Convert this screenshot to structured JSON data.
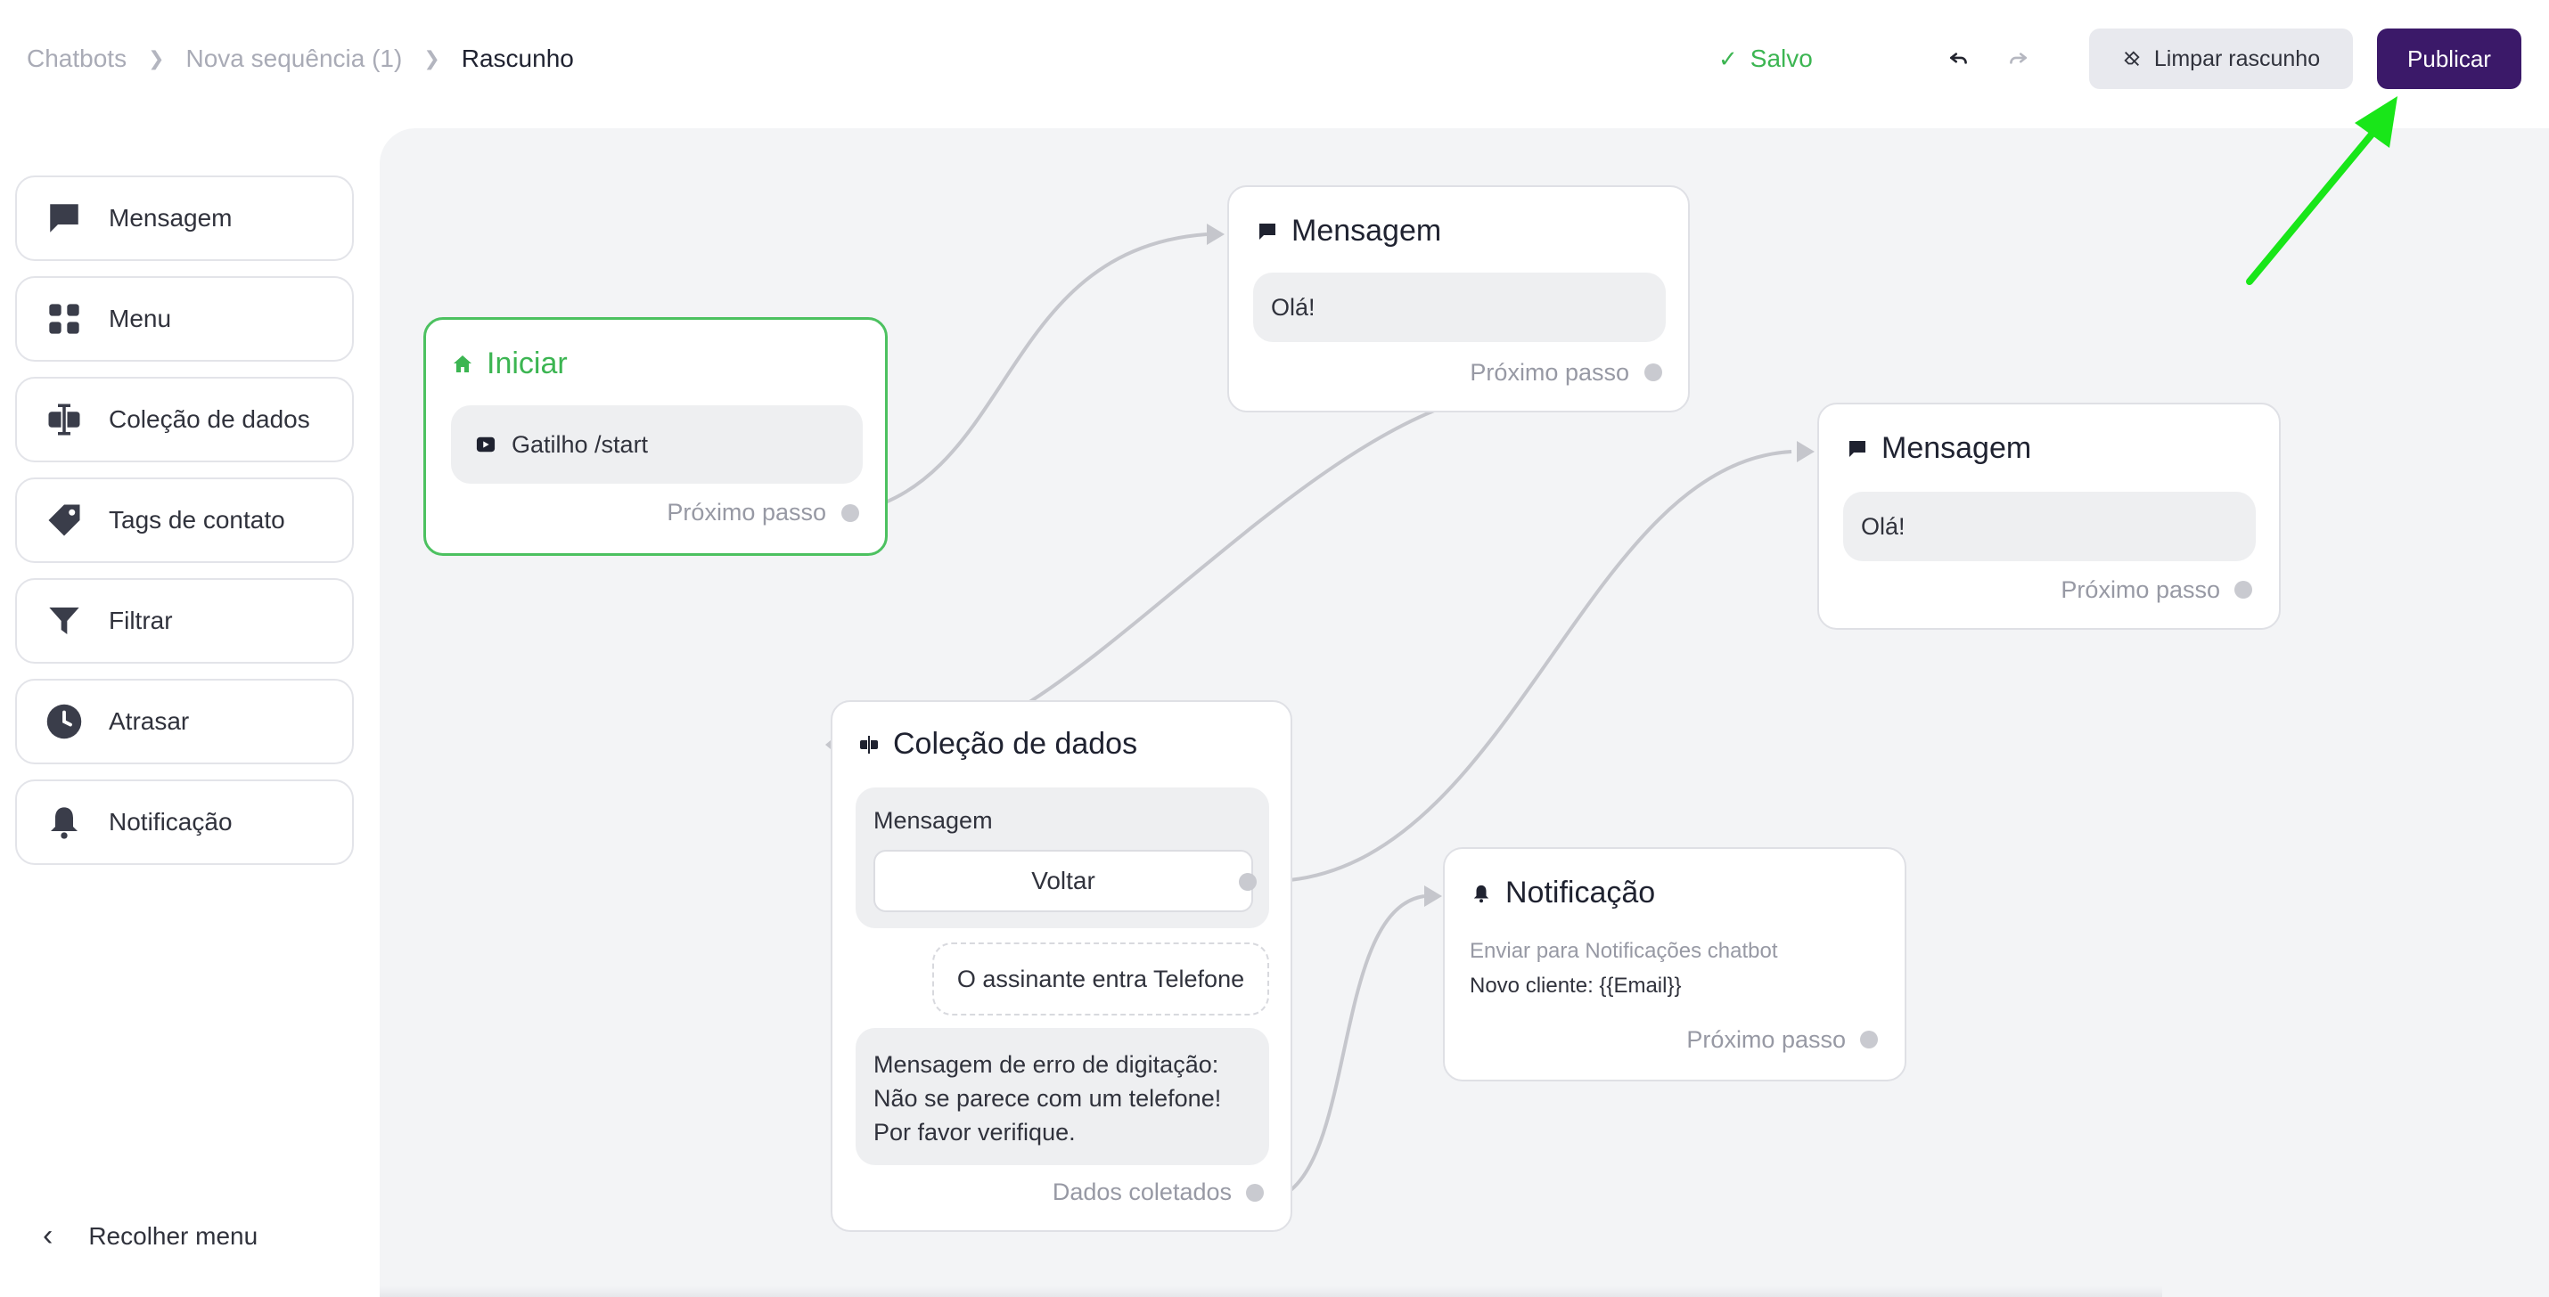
{
  "breadcrumb": {
    "root": "Chatbots",
    "sequence": "Nova sequência (1)",
    "current": "Rascunho"
  },
  "status": {
    "label": "Salvo",
    "color": "#3cb552"
  },
  "toolbar": {
    "clear_label": "Limpar rascunho",
    "publish_label": "Publicar",
    "publish_color": "#3b1969"
  },
  "sidebar": {
    "items": [
      {
        "label": "Mensagem",
        "icon": "message-icon"
      },
      {
        "label": "Menu",
        "icon": "grid-icon"
      },
      {
        "label": "Coleção de dados",
        "icon": "text-cursor-icon"
      },
      {
        "label": "Tags de contato",
        "icon": "tag-icon"
      },
      {
        "label": "Filtrar",
        "icon": "filter-icon"
      },
      {
        "label": "Atrasar",
        "icon": "clock-icon"
      },
      {
        "label": "Notificação",
        "icon": "bell-icon"
      }
    ],
    "collapse_label": "Recolher menu"
  },
  "nodes": {
    "start": {
      "title": "Iniciar",
      "trigger": "Gatilho /start",
      "next": "Próximo passo",
      "accent": "#4cc160"
    },
    "message1": {
      "title": "Mensagem",
      "text": "Olá!",
      "next": "Próximo passo"
    },
    "message2": {
      "title": "Mensagem",
      "text": "Olá!",
      "next": "Próximo passo"
    },
    "collection": {
      "title": "Coleção de dados",
      "message_label": "Mensagem",
      "button_label": "Voltar",
      "input_prompt": "O assinante entra Telefone",
      "error_line1": "Mensagem de erro de digitação:",
      "error_line2": "Não se parece com um telefone!",
      "error_line3": "Por favor verifique.",
      "collected": "Dados coletados"
    },
    "notification": {
      "title": "Notificação",
      "target": "Enviar para Notificações chatbot",
      "body": "Novo cliente: {{Email}}",
      "next": "Próximo passo"
    }
  },
  "annotation": {
    "arrow_color": "#19e619"
  }
}
